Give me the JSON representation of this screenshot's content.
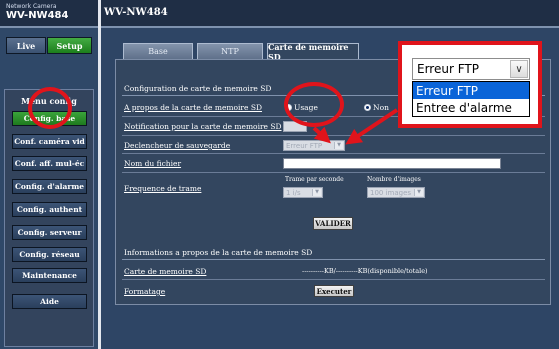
{
  "header": {
    "brand_line1": "Network Camera",
    "brand_model": "WV-NW484",
    "title": "WV-NW484"
  },
  "nav": {
    "live_label": "Live",
    "setup_label": "Setup"
  },
  "menu": {
    "title": "Menu config",
    "items": [
      {
        "label": "Config. base",
        "active": true
      },
      {
        "label": "Conf. caméra vid",
        "active": false
      },
      {
        "label": "Conf. aff. mul-éc",
        "active": false
      },
      {
        "label": "Config. d'alarme",
        "active": false
      },
      {
        "label": "Config. authent",
        "active": false
      },
      {
        "label": "Config. serveur",
        "active": false
      },
      {
        "label": "Config. réseau",
        "active": false
      },
      {
        "label": "Maintenance",
        "active": false
      },
      {
        "label": "Aide",
        "active": false
      }
    ]
  },
  "tabs": [
    {
      "label": "Base",
      "active": false
    },
    {
      "label": "NTP",
      "active": false
    },
    {
      "label": "Carte de memoire SD",
      "active": true
    }
  ],
  "sd_config": {
    "section_title": "Configuration de carte de memoire SD",
    "usage_row_label": "A propos de la carte de memoire SD",
    "usage_option1": "Usage",
    "usage_option2": "Non",
    "notification_label": "Notification pour la carte de memoire SD",
    "trigger_label": "Declencheur de sauvegarde",
    "trigger_value": "Erreur FTP",
    "filename_label": "Nom du fichier",
    "filename_value": "",
    "frequency_label": "Frequence de trame",
    "fps_caption": "Trame par seconde",
    "fps_value": "1 i/s",
    "images_caption": "Nombre d'images",
    "images_value": "100 images",
    "submit_label": "VALIDER"
  },
  "sd_info": {
    "section_title": "Informations a propos de la carte de memoire SD",
    "card_label": "Carte de memoire SD",
    "card_value": "----------KB/----------KB(disponible/totale)",
    "format_label": "Formatage",
    "format_button": "Executer"
  },
  "callout": {
    "selected_value": "Erreur FTP",
    "options": [
      "Erreur FTP",
      "Entree d'alarme"
    ],
    "selected_index": 0
  },
  "colors": {
    "annotation_red": "#e0141b",
    "setup_green": "#2e9b2e",
    "selection_blue": "#0a64d8"
  }
}
